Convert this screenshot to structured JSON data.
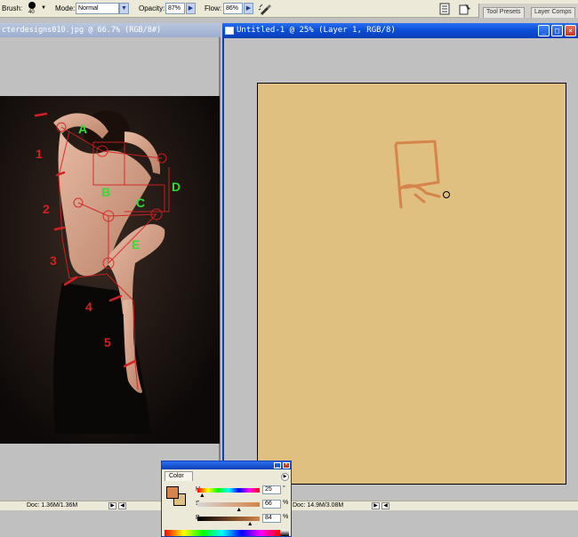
{
  "options_bar": {
    "brush_label": "Brush:",
    "brush_size": "40",
    "mode_label": "Mode:",
    "mode_value": "Normal",
    "opacity_label": "Opacity:",
    "opacity_value": "87%",
    "flow_label": "Flow:",
    "flow_value": "86%"
  },
  "palette_well": {
    "tabs": [
      "Tool Presets",
      "Layer Comps"
    ]
  },
  "document1": {
    "title": "cterdesigns010.jpg @ 66.7% (RGB/8#)",
    "status": "Doc: 1.36M/1.36M",
    "annotations": {
      "numbers": [
        "1",
        "2",
        "3",
        "4",
        "5"
      ],
      "letters": [
        "A",
        "B",
        "C",
        "D",
        "E"
      ]
    }
  },
  "document2": {
    "title": "Untitled-1 @ 25% (Layer 1, RGB/8)",
    "status": "Doc: 14.9M/3.08M",
    "canvas_color": "#e0c080"
  },
  "color_palette": {
    "tab": "Color",
    "foreground_color": "#d6844a",
    "background_color": "#e0c080",
    "sliders": [
      {
        "label": "H",
        "value": "25",
        "unit": "°",
        "fraction": 0.07
      },
      {
        "label": "S",
        "value": "66",
        "unit": "%",
        "fraction": 0.66
      },
      {
        "label": "B",
        "value": "84",
        "unit": "%",
        "fraction": 0.84
      }
    ]
  },
  "window_buttons": {
    "minimize": "_",
    "maximize": "□",
    "close": "×"
  }
}
